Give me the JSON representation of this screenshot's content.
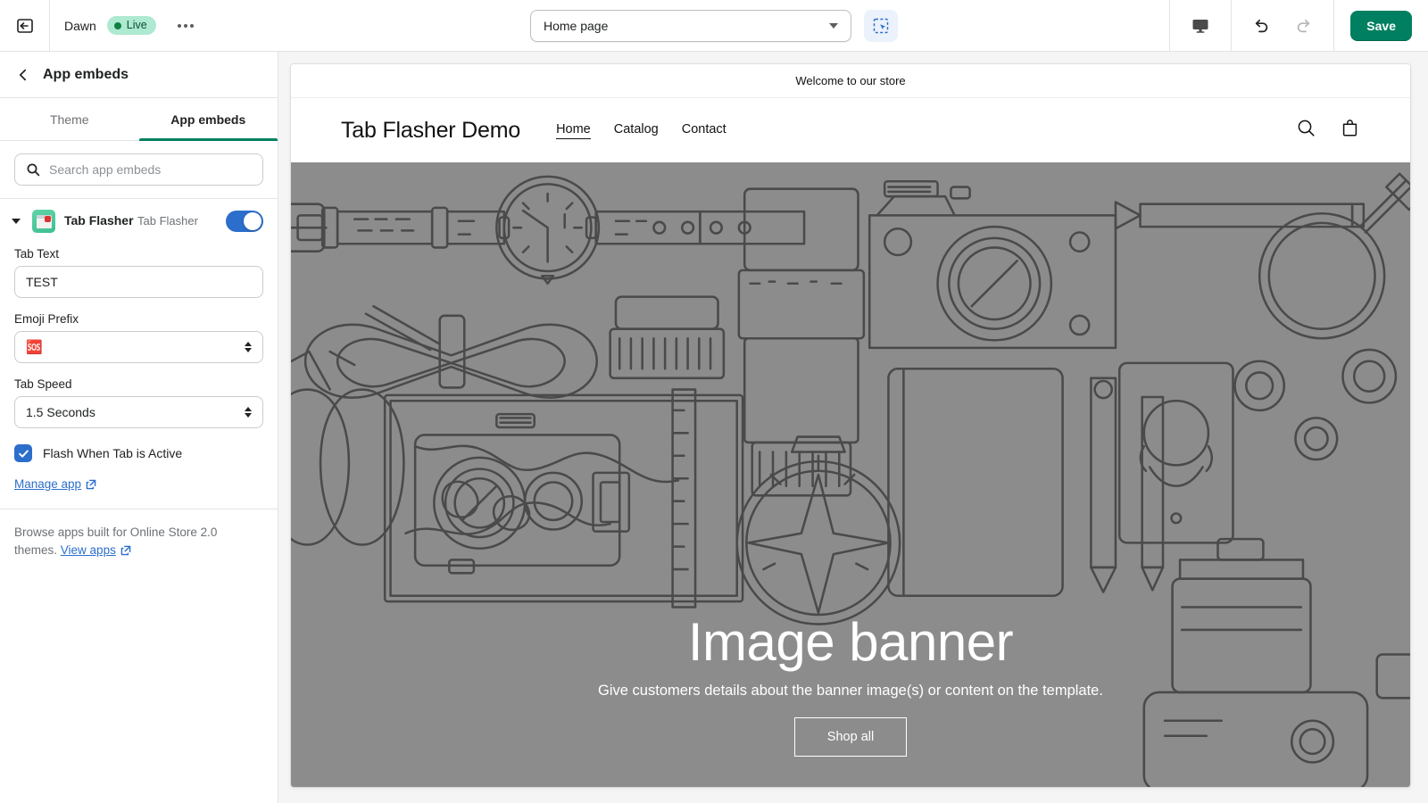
{
  "topbar": {
    "exit_icon": "exit-to-app-icon",
    "theme_name": "Dawn",
    "live_badge": "Live",
    "more_actions_icon": "more-horizontal-icon",
    "page_selector_value": "Home page",
    "page_selector_caret_icon": "chevron-down-icon",
    "select_tool_icon": "marquee-select-icon",
    "device_icon": "desktop-icon",
    "undo_icon": "undo-arrow-icon",
    "redo_icon": "redo-arrow-icon",
    "save_label": "Save",
    "save_color": "#008060",
    "live_badge_bg": "#aee9d1",
    "live_badge_dot": "#108043"
  },
  "sidebar": {
    "back_icon": "chevron-left-icon",
    "title": "App embeds",
    "tabs": [
      {
        "label": "Theme",
        "active": false
      },
      {
        "label": "App embeds",
        "active": true
      }
    ],
    "search": {
      "icon": "search-icon",
      "placeholder": "Search app embeds",
      "value": ""
    },
    "app": {
      "disclosure_icon": "triangle-down-icon",
      "icon": "tab-flasher-app-icon",
      "name": "Tab Flasher",
      "subtitle": "Tab Flasher",
      "toggle_on": true,
      "toggle_color": "#2c6ecb"
    },
    "settings": {
      "tab_text": {
        "label": "Tab Text",
        "value": "TEST"
      },
      "emoji_prefix": {
        "label": "Emoji Prefix",
        "value": "🆘",
        "stepper_icon": "stepper-updown-icon"
      },
      "tab_speed": {
        "label": "Tab Speed",
        "value": "1.5 Seconds",
        "stepper_icon": "stepper-updown-icon"
      },
      "flash_checkbox": {
        "label": "Flash When Tab is Active",
        "checked": true,
        "check_icon": "checkmark-icon"
      },
      "manage_app": {
        "label": "Manage app",
        "external_icon": "external-link-icon"
      }
    },
    "footer": {
      "text_before": "Browse apps built for Online Store 2.0 themes. ",
      "link_label": "View apps",
      "external_icon": "external-link-icon"
    }
  },
  "preview": {
    "announcement": "Welcome to our store",
    "store_name": "Tab Flasher Demo",
    "nav": [
      {
        "label": "Home",
        "active": true
      },
      {
        "label": "Catalog",
        "active": false
      },
      {
        "label": "Contact",
        "active": false
      }
    ],
    "search_icon": "search-icon",
    "cart_icon": "shopping-bag-icon",
    "banner": {
      "heading": "Image banner",
      "subheading": "Give customers details about the banner image(s) or content on the template.",
      "button_label": "Shop all",
      "background_color": "#8c8c8c",
      "line_art_color": "#4a4a4a"
    }
  }
}
